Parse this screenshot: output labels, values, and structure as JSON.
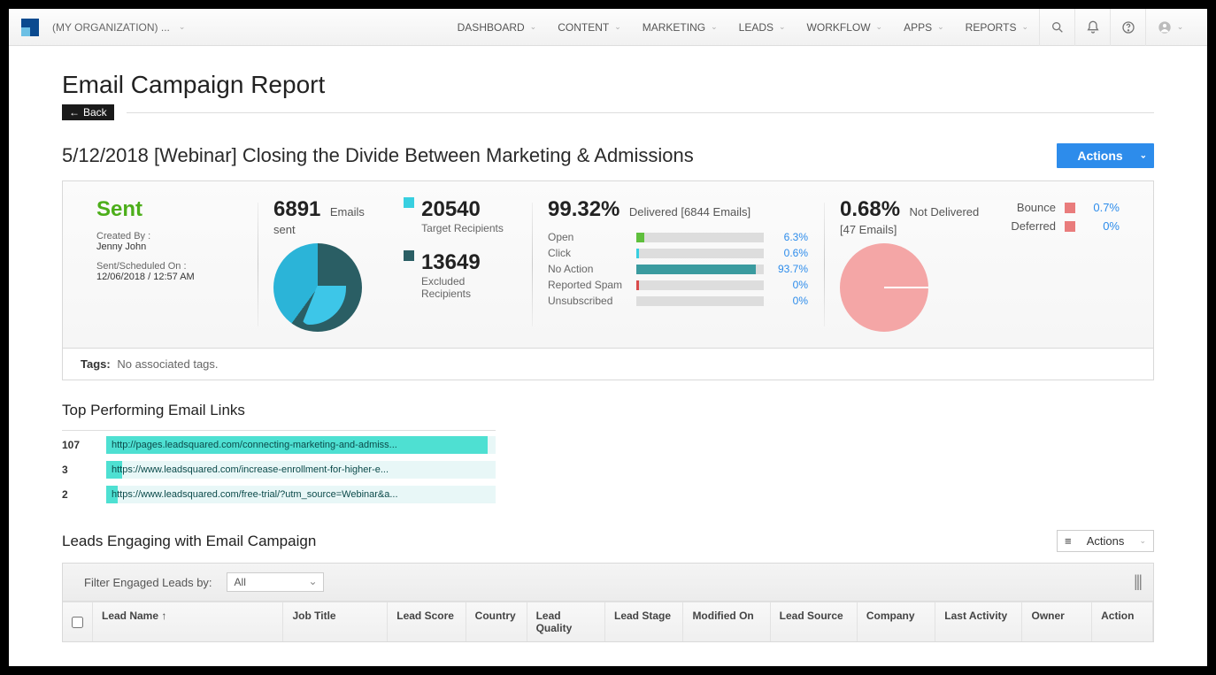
{
  "org": "(MY ORGANIZATION) ...",
  "nav": [
    "DASHBOARD",
    "CONTENT",
    "MARKETING",
    "LEADS",
    "WORKFLOW",
    "APPS",
    "REPORTS"
  ],
  "pageTitle": "Email Campaign Report",
  "back": "Back",
  "campaignTitle": "5/12/2018 [Webinar] Closing the Divide Between Marketing & Admissions",
  "actionsLabel": "Actions",
  "status": {
    "value": "Sent",
    "createdByLabel": "Created By :",
    "createdBy": "Jenny John",
    "sentLabel": "Sent/Scheduled On :",
    "sentOn": "12/06/2018 / 12:57 AM"
  },
  "emails": {
    "sentCount": "6891",
    "sentLabel": "Emails sent",
    "target": {
      "value": "20540",
      "label": "Target Recipients",
      "color": "#38cfe0"
    },
    "excluded": {
      "value": "13649",
      "label": "Excluded Recipients",
      "color": "#2a5e64"
    }
  },
  "delivered": {
    "pct": "99.32%",
    "sub": "Delivered [6844 Emails]",
    "rows": [
      {
        "label": "Open",
        "pct": "6.3%",
        "width": 6.3,
        "color": "#5fbf3c"
      },
      {
        "label": "Click",
        "pct": "0.6%",
        "width": 2,
        "color": "#38cfe0"
      },
      {
        "label": "No Action",
        "pct": "93.7%",
        "width": 93.7,
        "color": "#3a9b9f"
      },
      {
        "label": "Reported Spam",
        "pct": "0%",
        "width": 2,
        "color": "#d94b4b"
      },
      {
        "label": "Unsubscribed",
        "pct": "0%",
        "width": 0,
        "color": "#3a9b9f"
      }
    ]
  },
  "notDelivered": {
    "pct": "0.68%",
    "sub": "Not Delivered [47 Emails]",
    "rows": [
      {
        "label": "Bounce",
        "pct": "0.7%"
      },
      {
        "label": "Deferred",
        "pct": "0%"
      }
    ]
  },
  "tags": {
    "label": "Tags:",
    "value": "No associated tags."
  },
  "topLinks": {
    "heading": "Top Performing Email Links",
    "rows": [
      {
        "count": "107",
        "url": "http://pages.leadsquared.com/connecting-marketing-and-admiss...",
        "fill": 98
      },
      {
        "count": "3",
        "url": "https://www.leadsquared.com/increase-enrollment-for-higher-e...",
        "fill": 4
      },
      {
        "count": "2",
        "url": "https://www.leadsquared.com/free-trial/?utm_source=Webinar&a...",
        "fill": 3
      }
    ]
  },
  "leads": {
    "heading": "Leads Engaging with Email Campaign",
    "actionsLabel": "Actions",
    "filterLabel": "Filter Engaged Leads by:",
    "filterValue": "All",
    "columns": [
      "Lead Name ↑",
      "Job Title",
      "Lead Score",
      "Country",
      "Lead Quality",
      "Lead Stage",
      "Modified On",
      "Lead Source",
      "Company",
      "Last Activity",
      "Owner",
      "Action"
    ]
  },
  "chart_data": [
    {
      "type": "pie",
      "title": "Emails sent breakdown",
      "series": [
        {
          "name": "Target Recipients",
          "value": 20540
        },
        {
          "name": "Excluded Recipients",
          "value": 13649
        }
      ]
    },
    {
      "type": "bar",
      "title": "Delivered [6844 Emails]",
      "categories": [
        "Open",
        "Click",
        "No Action",
        "Reported Spam",
        "Unsubscribed"
      ],
      "values": [
        6.3,
        0.6,
        93.7,
        0,
        0
      ],
      "ylabel": "%",
      "ylim": [
        0,
        100
      ]
    },
    {
      "type": "pie",
      "title": "Not Delivered [47 Emails]",
      "series": [
        {
          "name": "Bounce",
          "value": 0.7
        },
        {
          "name": "Deferred",
          "value": 0.0
        }
      ]
    },
    {
      "type": "bar",
      "title": "Top Performing Email Links",
      "categories": [
        "http://pages.leadsquared.com/connecting-marketing-and-admiss...",
        "https://www.leadsquared.com/increase-enrollment-for-higher-e...",
        "https://www.leadsquared.com/free-trial/?utm_source=Webinar&a..."
      ],
      "values": [
        107,
        3,
        2
      ]
    }
  ]
}
